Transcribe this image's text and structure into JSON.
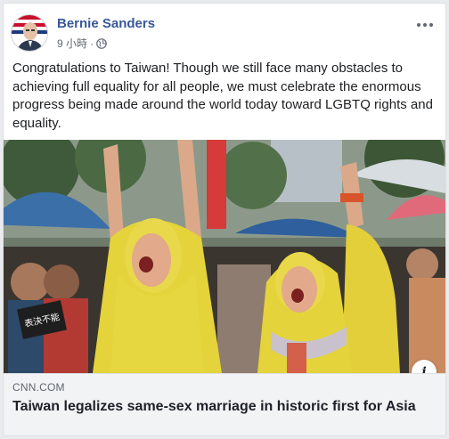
{
  "post": {
    "author": "Bernie Sanders",
    "timestamp": "9 小時",
    "separator": "·",
    "privacy_icon": "globe-icon",
    "more_icon": "more-options-icon",
    "text": "Congratulations to Taiwan! Though we still face many obstacles to achieving full equality for all people, we must celebrate the enormous progress being made around the world today toward LGBTQ rights and equality."
  },
  "photo": {
    "sign_text": "表決不能",
    "info_icon": "info-icon",
    "info_glyph": "i"
  },
  "link": {
    "domain": "CNN.COM",
    "title": "Taiwan legalizes same-sex marriage in historic first for Asia"
  },
  "colors": {
    "author": "#385898",
    "meta": "#606770",
    "raincoat": "#e4d33a",
    "link_bg": "#f2f3f5"
  }
}
